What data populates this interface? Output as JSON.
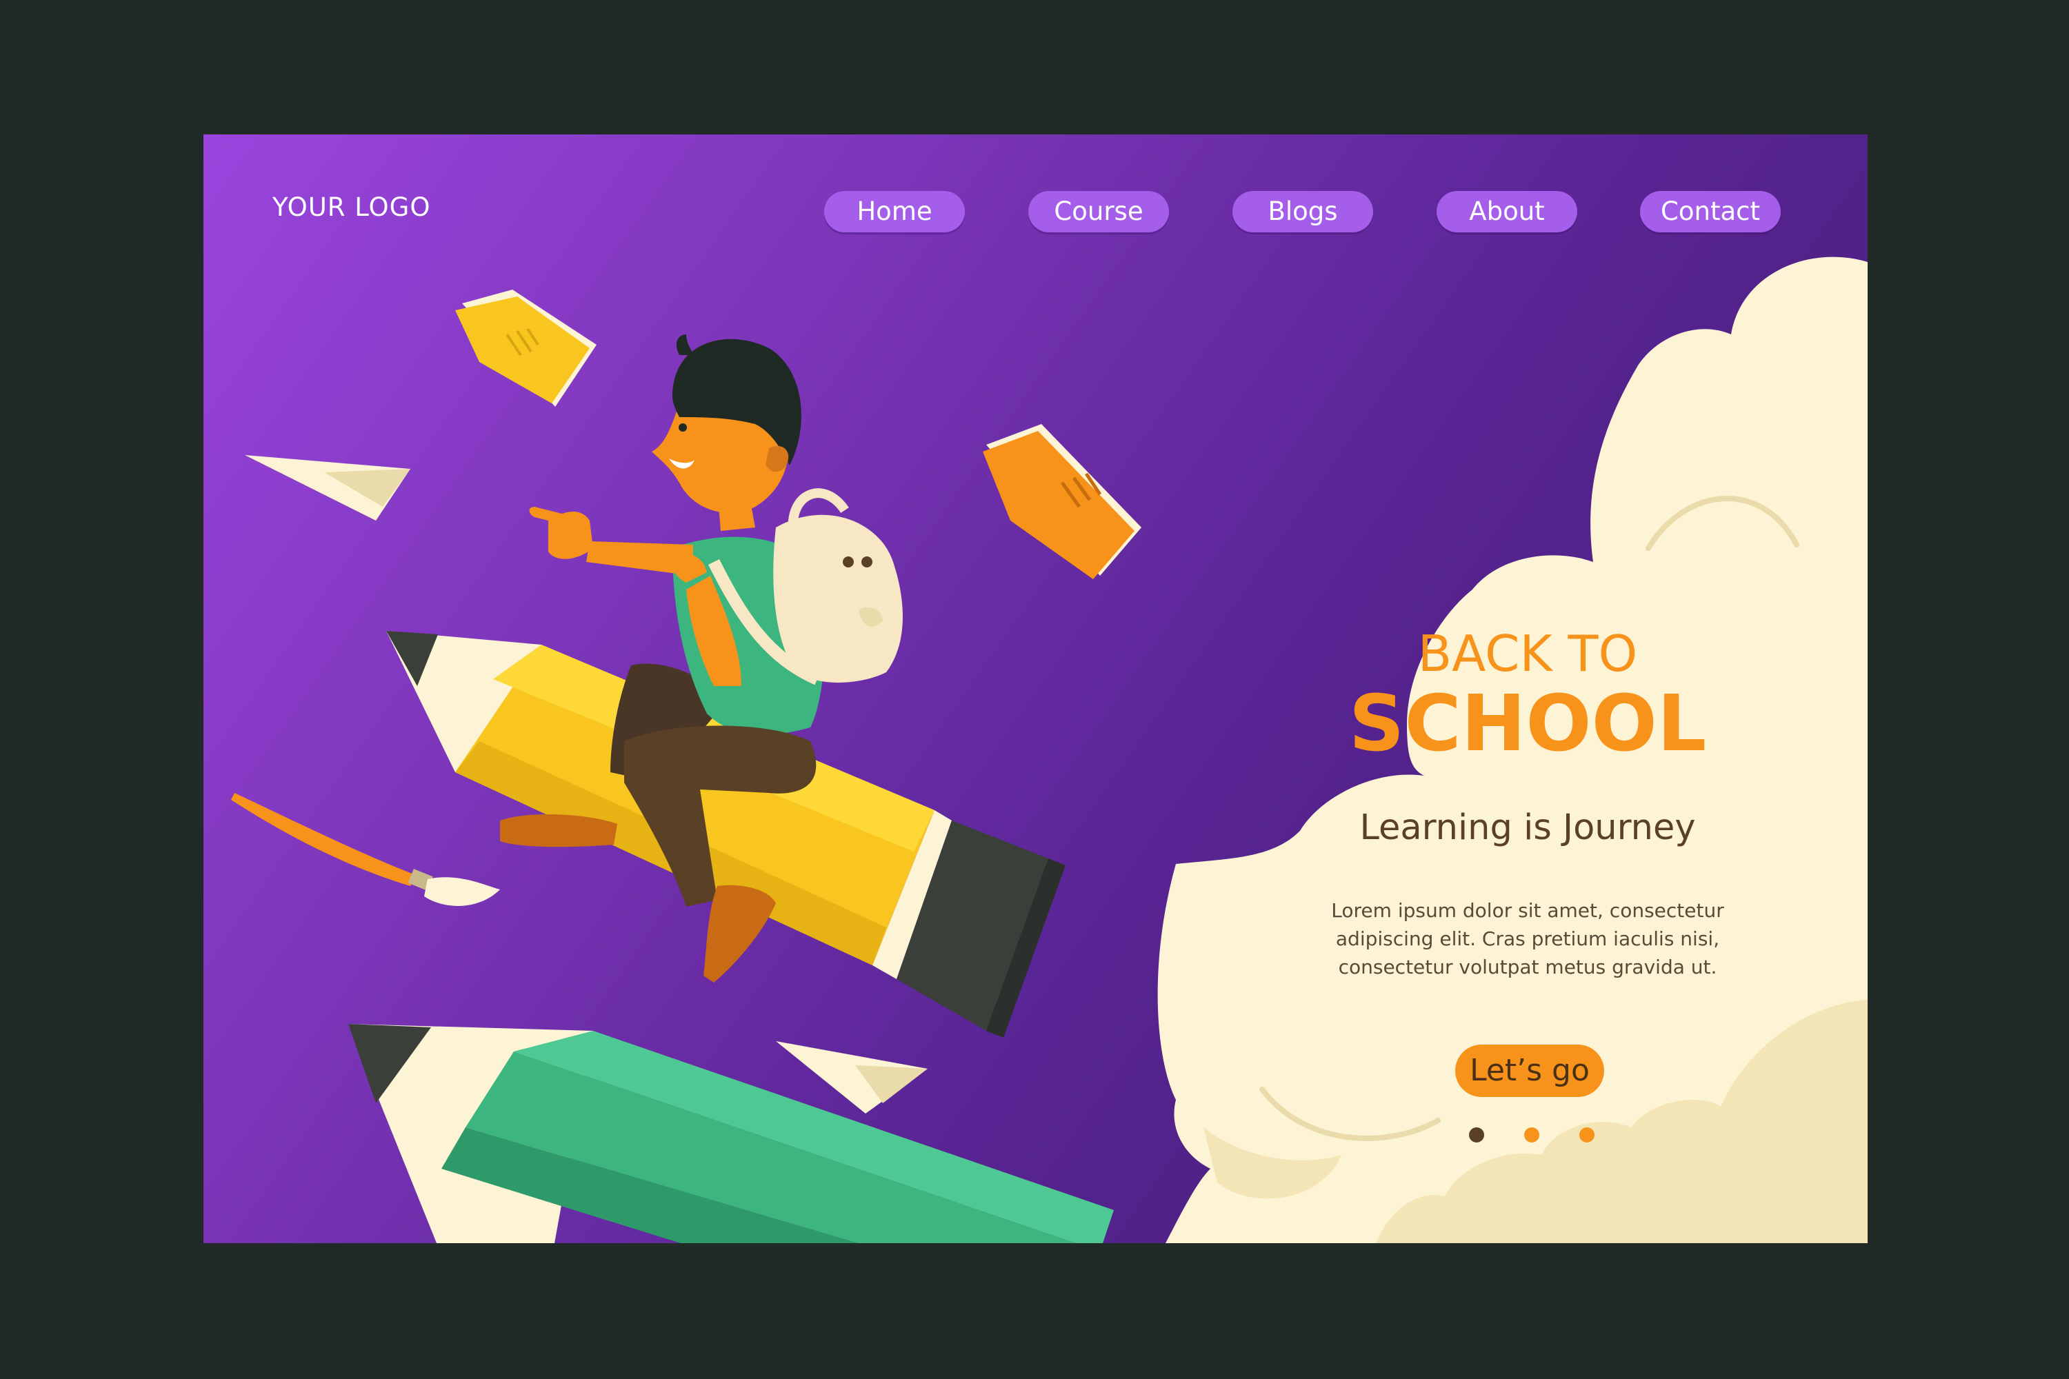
{
  "header": {
    "logo": "YOUR LOGO",
    "nav": [
      {
        "label": "Home"
      },
      {
        "label": "Course"
      },
      {
        "label": "Blogs"
      },
      {
        "label": "About"
      },
      {
        "label": "Contact"
      }
    ]
  },
  "hero": {
    "kicker": "BACK TO",
    "title": "SCHOOL",
    "subtitle": "Learning is Journey",
    "body": "Lorem ipsum dolor sit amet, consectetur adipiscing elit. Cras pretium iaculis nisi, consectetur volutpat metus gravida ut.",
    "cta_label": "Let’s go"
  },
  "carousel": {
    "slide_count": 3,
    "active_index": 0
  },
  "colors": {
    "background": "#222a27",
    "gradient_start": "#9b45de",
    "gradient_end": "#3e1966",
    "nav_pill": "#a45ee9",
    "accent": "#f7931a",
    "cloud": "#fdf4d6",
    "text_dark": "#5a4025",
    "dot_active": "#5a4025",
    "dot_inactive": "#f7931a"
  },
  "illustration": {
    "subject": "boy riding a yellow pencil rocket",
    "icons": [
      "paper-plane-icon",
      "book-icon",
      "paintbrush-icon",
      "pencil-icon",
      "backpack-icon",
      "cloud-icon"
    ]
  }
}
